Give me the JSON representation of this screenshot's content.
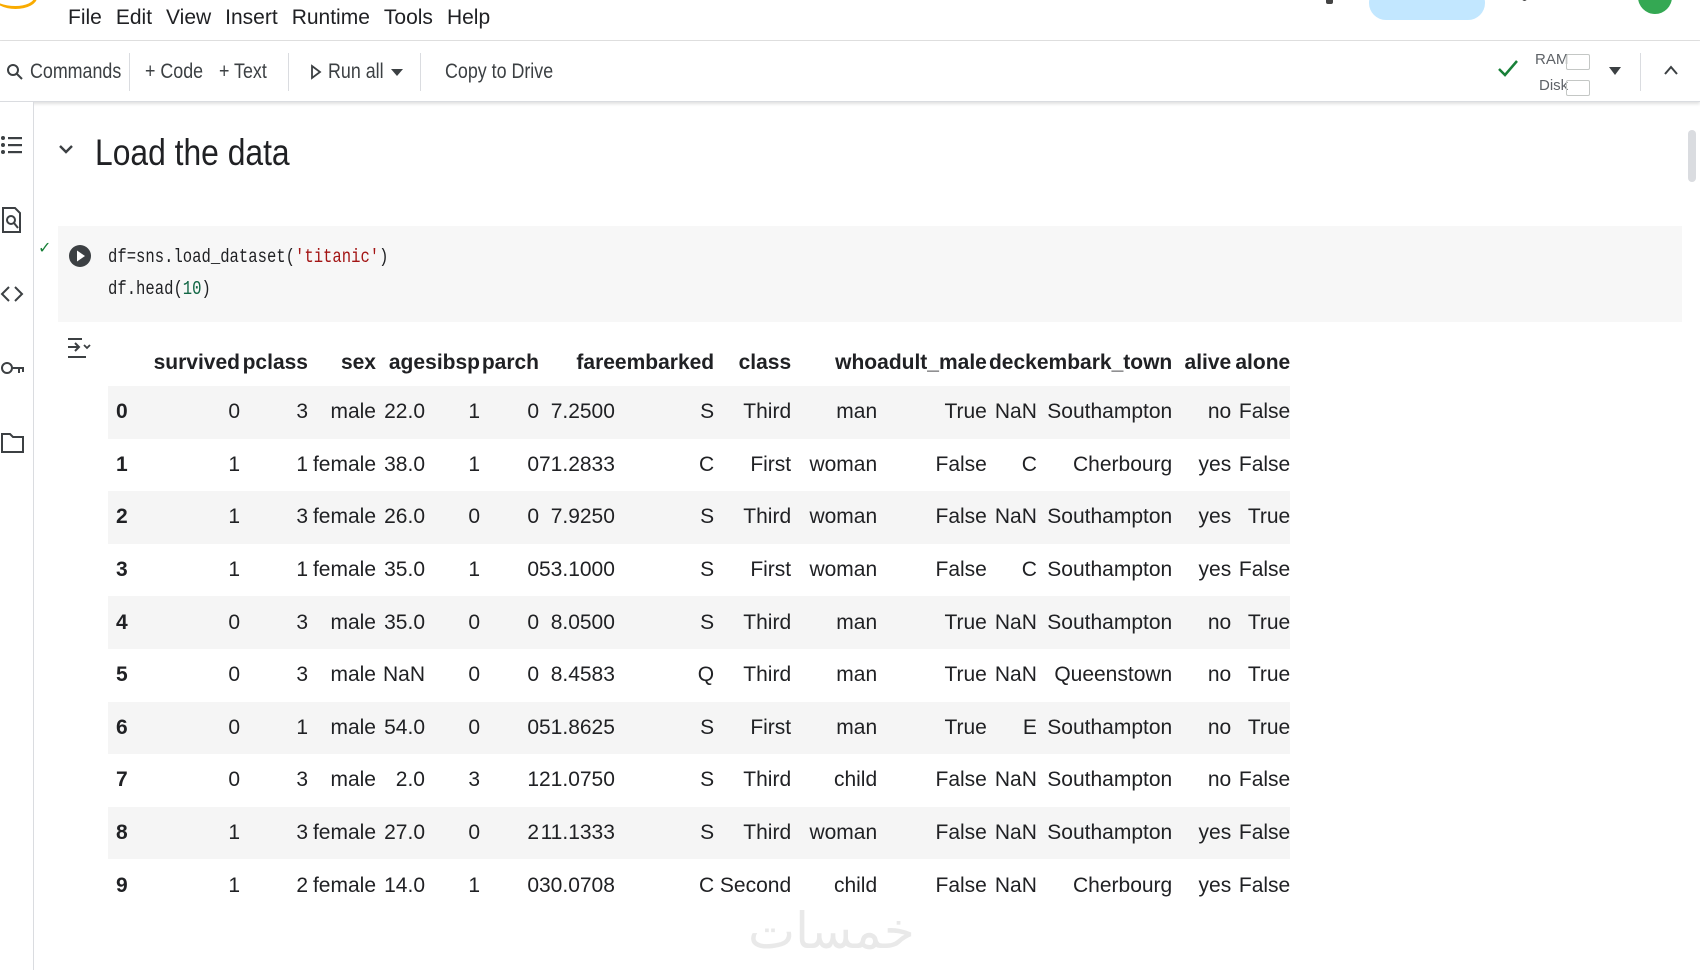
{
  "menu": [
    "File",
    "Edit",
    "View",
    "Insert",
    "Runtime",
    "Tools",
    "Help"
  ],
  "toolbar": {
    "commands": "Commands",
    "code": "+ Code",
    "text": "+ Text",
    "run_all": "Run all",
    "copy_to_drive": "Copy to Drive",
    "ram": "RAM",
    "disk": "Disk"
  },
  "section": {
    "title": "Load the data"
  },
  "code_cell": {
    "line1": {
      "pre": "df=sns.load_dataset(",
      "str": "'titanic'",
      "post": ")"
    },
    "line2": {
      "pre": "df.head(",
      "num": "10",
      "post": ")"
    }
  },
  "table": {
    "columns": [
      "survived",
      "pclass",
      "sex",
      "age",
      "sibsp",
      "parch",
      "fare",
      "embarked",
      "class",
      "who",
      "adult_male",
      "deck",
      "embark_town",
      "alive",
      "alone"
    ],
    "rows": [
      [
        "0",
        "0",
        "3",
        "male",
        "22.0",
        "1",
        "0",
        "7.2500",
        "S",
        "Third",
        "man",
        "True",
        "NaN",
        "Southampton",
        "no",
        "False"
      ],
      [
        "1",
        "1",
        "1",
        "female",
        "38.0",
        "1",
        "0",
        "71.2833",
        "C",
        "First",
        "woman",
        "False",
        "C",
        "Cherbourg",
        "yes",
        "False"
      ],
      [
        "2",
        "1",
        "3",
        "female",
        "26.0",
        "0",
        "0",
        "7.9250",
        "S",
        "Third",
        "woman",
        "False",
        "NaN",
        "Southampton",
        "yes",
        "True"
      ],
      [
        "3",
        "1",
        "1",
        "female",
        "35.0",
        "1",
        "0",
        "53.1000",
        "S",
        "First",
        "woman",
        "False",
        "C",
        "Southampton",
        "yes",
        "False"
      ],
      [
        "4",
        "0",
        "3",
        "male",
        "35.0",
        "0",
        "0",
        "8.0500",
        "S",
        "Third",
        "man",
        "True",
        "NaN",
        "Southampton",
        "no",
        "True"
      ],
      [
        "5",
        "0",
        "3",
        "male",
        "NaN",
        "0",
        "0",
        "8.4583",
        "Q",
        "Third",
        "man",
        "True",
        "NaN",
        "Queenstown",
        "no",
        "True"
      ],
      [
        "6",
        "0",
        "1",
        "male",
        "54.0",
        "0",
        "0",
        "51.8625",
        "S",
        "First",
        "man",
        "True",
        "E",
        "Southampton",
        "no",
        "True"
      ],
      [
        "7",
        "0",
        "3",
        "male",
        "2.0",
        "3",
        "1",
        "21.0750",
        "S",
        "Third",
        "child",
        "False",
        "NaN",
        "Southampton",
        "no",
        "False"
      ],
      [
        "8",
        "1",
        "3",
        "female",
        "27.0",
        "0",
        "2",
        "11.1333",
        "S",
        "Third",
        "woman",
        "False",
        "NaN",
        "Southampton",
        "yes",
        "False"
      ],
      [
        "9",
        "1",
        "2",
        "female",
        "14.0",
        "1",
        "0",
        "30.0708",
        "C",
        "Second",
        "child",
        "False",
        "NaN",
        "Cherbourg",
        "yes",
        "False"
      ]
    ]
  },
  "watermark": "خمسات",
  "icons": {
    "rail": [
      "toc-icon",
      "find-icon",
      "code-snippets-icon",
      "secrets-key-icon",
      "files-folder-icon"
    ]
  },
  "colors": {
    "accent_check": "#188038",
    "string": "#a31515",
    "number": "#116644"
  }
}
